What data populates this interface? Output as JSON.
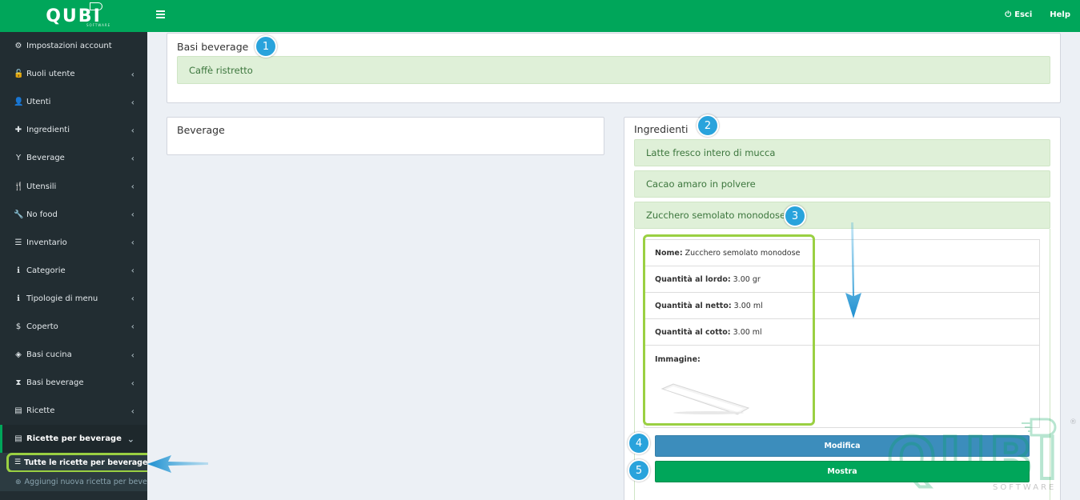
{
  "brand": {
    "logo": "QUBI",
    "sub": "SOFTWARE"
  },
  "header": {
    "logout_label": "Esci",
    "help_label": "Help"
  },
  "sidebar": {
    "items": [
      {
        "label": "Impostazioni account",
        "icon": "gear-icon",
        "glyph": "⚙",
        "chevron": false
      },
      {
        "label": "Ruoli utente",
        "icon": "unlock-icon",
        "glyph": "🔓",
        "chevron": true
      },
      {
        "label": "Utenti",
        "icon": "user-icon",
        "glyph": "👤",
        "chevron": true
      },
      {
        "label": "Ingredienti",
        "icon": "puzzle-icon",
        "glyph": "✚",
        "chevron": true
      },
      {
        "label": "Beverage",
        "icon": "cocktail-icon",
        "glyph": "Y",
        "chevron": true
      },
      {
        "label": "Utensili",
        "icon": "cutlery-icon",
        "glyph": "🍴",
        "chevron": true
      },
      {
        "label": "No food",
        "icon": "wrench-icon",
        "glyph": "🔧",
        "chevron": true
      },
      {
        "label": "Inventario",
        "icon": "list-icon",
        "glyph": "☰",
        "chevron": true
      },
      {
        "label": "Categorie",
        "icon": "info-icon",
        "glyph": "ℹ",
        "chevron": true
      },
      {
        "label": "Tipologie di menu",
        "icon": "info-icon",
        "glyph": "ℹ",
        "chevron": true
      },
      {
        "label": "Coperto",
        "icon": "dollar-icon",
        "glyph": "$",
        "chevron": true
      },
      {
        "label": "Basi cucina",
        "icon": "cube-icon",
        "glyph": "◈",
        "chevron": true
      },
      {
        "label": "Basi beverage",
        "icon": "hourglass-icon",
        "glyph": "⧗",
        "chevron": true
      },
      {
        "label": "Ricette",
        "icon": "file-icon",
        "glyph": "▤",
        "chevron": true
      },
      {
        "label": "Ricette per beverage",
        "icon": "file-icon",
        "glyph": "▤",
        "chevron": true,
        "active": true
      }
    ],
    "submenu": [
      {
        "label": "Tutte le ricette per beverage",
        "current": true
      },
      {
        "label": "Aggiungi nuova ricetta per beverage",
        "current": false
      }
    ]
  },
  "main": {
    "basi_title": "Basi beverage",
    "basi_items": [
      "Caffè ristretto"
    ],
    "beverage_title": "Beverage",
    "ingredienti_title": "Ingredienti",
    "ingredienti_items": [
      "Latte fresco intero di mucca",
      "Cacao amaro in polvere",
      "Zucchero semolato monodose"
    ],
    "detail": {
      "nome_label": "Nome:",
      "nome_value": "Zucchero semolato monodose",
      "lordo_label": "Quantità al lordo:",
      "lordo_value": "3.00 gr",
      "netto_label": "Quantità al netto:",
      "netto_value": "3.00 ml",
      "cotto_label": "Quantità al cotto:",
      "cotto_value": "3.00 ml",
      "immagine_label": "Immagine:"
    },
    "buttons": {
      "edit": "Modifica",
      "show": "Mostra"
    }
  },
  "annotations": [
    "1",
    "2",
    "3",
    "4",
    "5"
  ],
  "colors": {
    "primary": "#00a65a",
    "sidebar": "#222d32",
    "info": "#3c8dbc",
    "callout": "#29a3dc",
    "highlight": "#9ad042"
  }
}
